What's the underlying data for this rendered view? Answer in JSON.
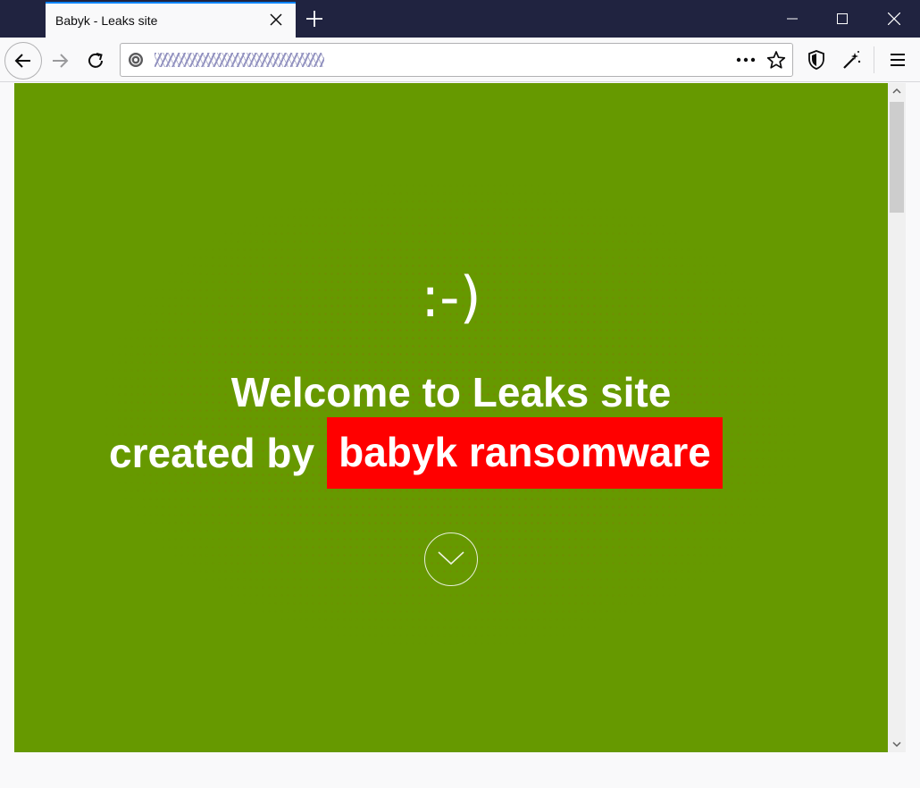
{
  "browser": {
    "tab_title": "Babyk - Leaks site",
    "url_obfuscated": true
  },
  "page": {
    "background_color": "#669900",
    "smiley": ":-)",
    "headline_line1": "Welcome to Leaks site",
    "headline_line2_prefix": "created by",
    "headline_highlight": "babyk ransomware",
    "highlight_color": "#ff0000"
  },
  "icons": {
    "scroll_down": "chevron-down-icon"
  },
  "colors": {
    "titlebar": "#202340",
    "tab_accent": "#0a84ff"
  }
}
